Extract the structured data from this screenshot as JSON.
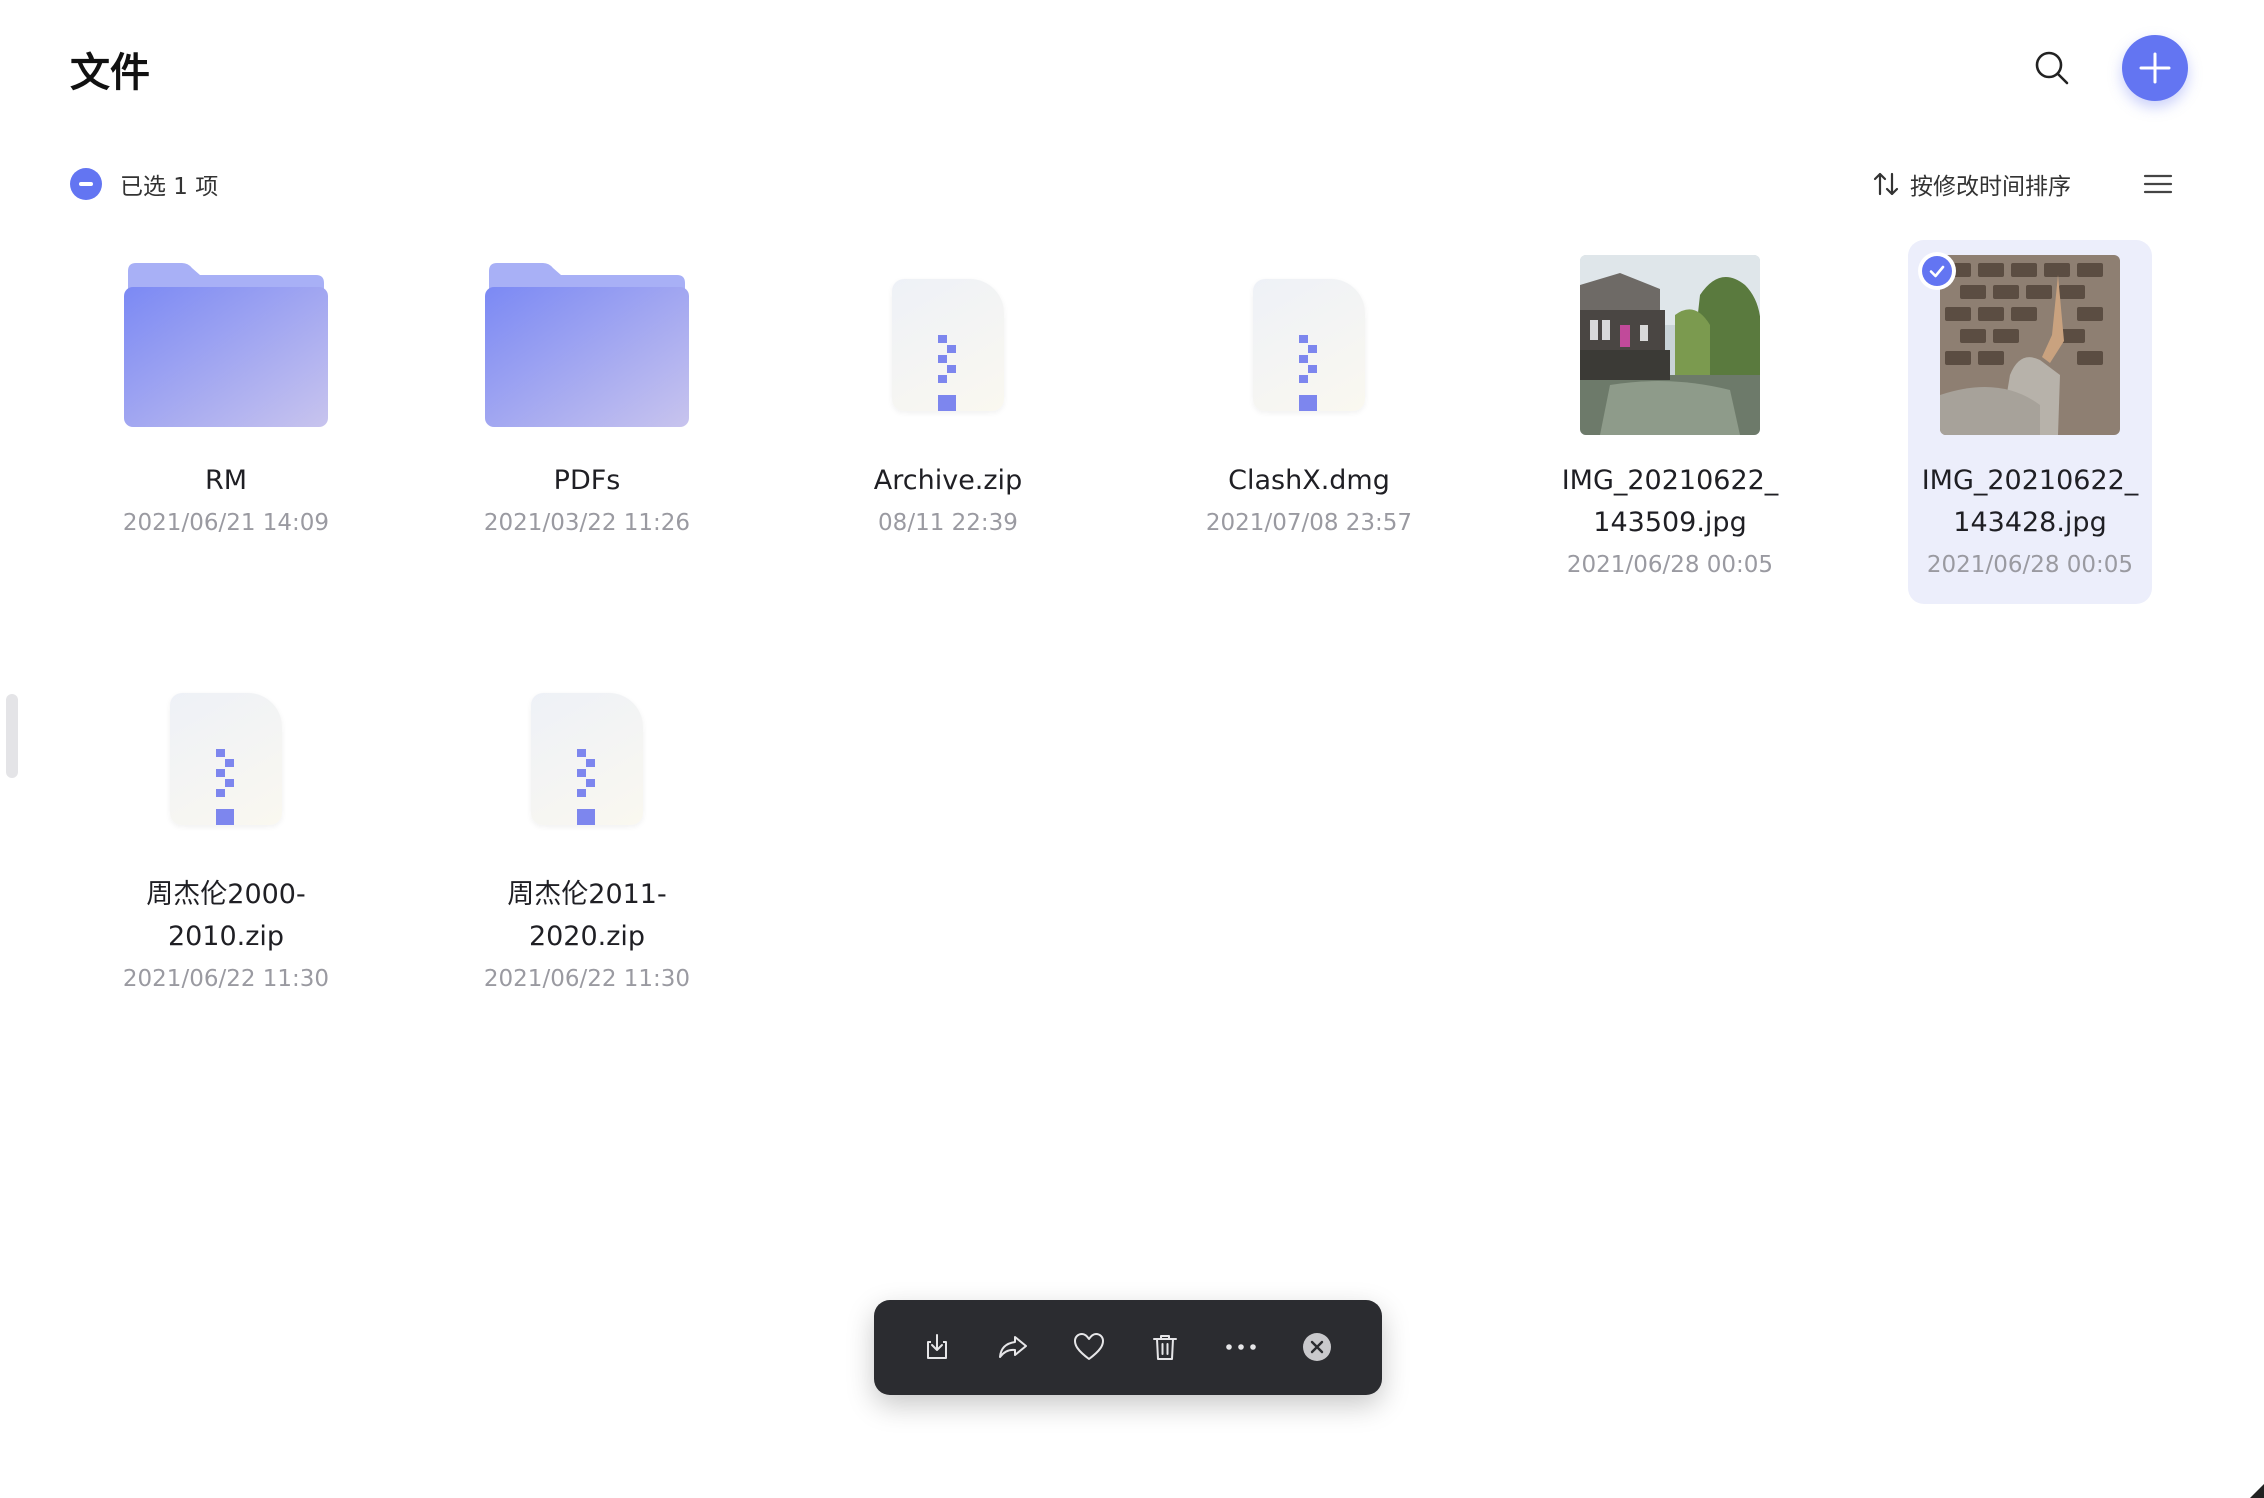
{
  "header": {
    "title": "文件"
  },
  "selection": {
    "text": "已选 1 项"
  },
  "sort": {
    "label": "按修改时间排序"
  },
  "files": [
    {
      "name": "RM",
      "date": "2021/06/21 14:09",
      "type": "folder",
      "selected": false
    },
    {
      "name": "PDFs",
      "date": "2021/03/22 11:26",
      "type": "folder",
      "selected": false
    },
    {
      "name": "Archive.zip",
      "date": "08/11 22:39",
      "type": "archive",
      "selected": false
    },
    {
      "name": "ClashX.dmg",
      "date": "2021/07/08 23:57",
      "type": "archive",
      "selected": false
    },
    {
      "name_line1": "IMG_20210622_",
      "name_line2": "143509.jpg",
      "date": "2021/06/28 00:05",
      "type": "image",
      "selected": false
    },
    {
      "name_line1": "IMG_20210622_",
      "name_line2": "143428.jpg",
      "date": "2021/06/28 00:05",
      "type": "image",
      "selected": true
    },
    {
      "name_line1": "周杰伦2000-",
      "name_line2": "2010.zip",
      "date": "2021/06/22 11:30",
      "type": "archive",
      "selected": false
    },
    {
      "name_line1": "周杰伦2011-",
      "name_line2": "2020.zip",
      "date": "2021/06/22 11:30",
      "type": "archive",
      "selected": false
    }
  ],
  "toolbar": {
    "actions": [
      "download-icon",
      "share-icon",
      "heart-icon",
      "trash-icon",
      "more-icon",
      "close-icon"
    ]
  },
  "colors": {
    "accent": "#6375f2",
    "selected_bg": "#eceefb",
    "toolbar_bg": "#2b2c30",
    "date_text": "#9a9aa1"
  }
}
